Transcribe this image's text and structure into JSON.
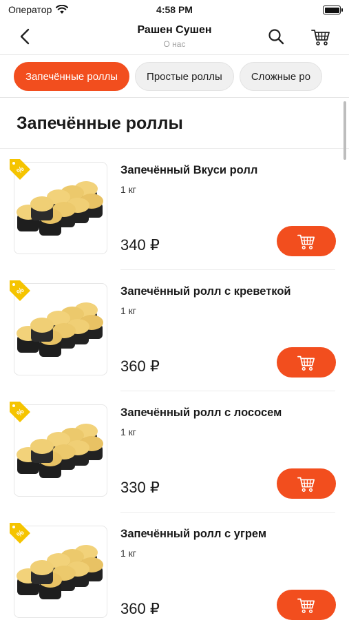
{
  "status_bar": {
    "carrier": "Оператор",
    "time": "4:58 PM"
  },
  "nav": {
    "title": "Рашен Сушен",
    "subtitle": "О нас"
  },
  "tabs": [
    {
      "label": "Запечённые роллы",
      "active": true
    },
    {
      "label": "Простые роллы",
      "active": false
    },
    {
      "label": "Сложные ро",
      "active": false
    }
  ],
  "section": {
    "title": "Запечённые роллы"
  },
  "products": [
    {
      "name": "Запечённый Вкуси ролл",
      "weight": "1 кг",
      "price": "340 ₽"
    },
    {
      "name": "Запечённый ролл с креветкой",
      "weight": "1 кг",
      "price": "360 ₽"
    },
    {
      "name": "Запечённый ролл с лососем",
      "weight": "1 кг",
      "price": "330 ₽"
    },
    {
      "name": "Запечённый ролл с угрем",
      "weight": "1 кг",
      "price": "360 ₽"
    }
  ],
  "colors": {
    "accent": "#f24e1e",
    "promo_tag": "#f5c400"
  },
  "icons": {
    "back": "chevron-left-icon",
    "search": "search-icon",
    "cart": "cart-icon",
    "promo": "percent-tag-icon"
  }
}
